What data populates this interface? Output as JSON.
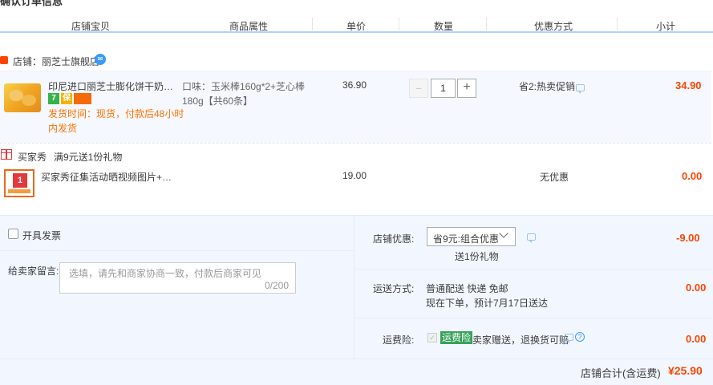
{
  "section_title": "确认订单信息",
  "columns": [
    "店铺宝贝",
    "商品属性",
    "单价",
    "数量",
    "优惠方式",
    "小计"
  ],
  "shop": {
    "name": "店铺：丽芝士旗舰店",
    "ww_icon": "chat-badge-icon"
  },
  "item": {
    "title": "印尼进口丽芝士膨化饼干奶酪味...",
    "badges": [
      "7",
      "保",
      "卡"
    ],
    "ship_time": "发货时间：现货，付款后48小时内发货",
    "attr": "口味：玉米棒160g*2+芝心棒180g【共60条】",
    "price": "36.90",
    "quantity": "1",
    "minus": "−",
    "plus": "+",
    "promo": "省2:热卖促销",
    "subtotal": "34.90"
  },
  "gift": {
    "label": "买家秀",
    "rule": "满9元送1份礼物",
    "title": "买家秀征集活动晒视频图片+20...",
    "price": "19.00",
    "promo": "无优惠",
    "subtotal": "0.00"
  },
  "invoice": {
    "label": "开具发票"
  },
  "message": {
    "label": "给卖家留言:",
    "placeholder": "选填，请先和商家协商一致，付款后商家可见",
    "count": "0/200"
  },
  "shop_discount": {
    "label": "店铺优惠:",
    "selected": "省9元:组合优惠",
    "note": "送1份礼物",
    "amount": "-9.00"
  },
  "shipping": {
    "label": "运送方式:",
    "method": "普通配送 快递 免邮",
    "eta": "现在下单，预计7月17日送达",
    "amount": "0.00"
  },
  "insurance": {
    "label": "运费险:",
    "tag": "运费险",
    "desc": "卖家赠送，退换货可赔",
    "help": "?",
    "amount": "0.00"
  },
  "total": {
    "label": "店铺合计(含运费)",
    "amount": "¥25.90"
  },
  "colors": {
    "accent": "#ff4400",
    "ship_note": "#ff7200",
    "panel": "#f2f7ff",
    "header_line": "#b2d1ff"
  }
}
